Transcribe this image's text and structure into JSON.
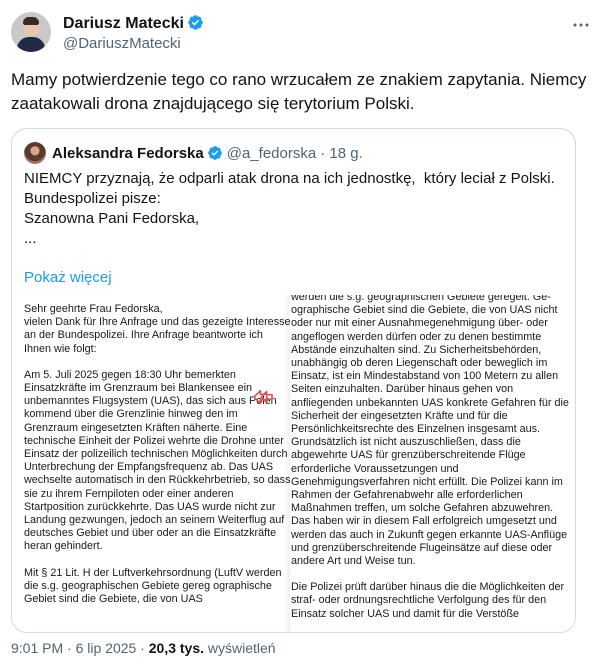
{
  "author": {
    "name": "Dariusz Matecki",
    "handle": "@DariuszMatecki"
  },
  "tweet": {
    "text": "Mamy potwierdzenie tego co rano wrzucałem ze znakiem zapytania. Niemcy zaatakowali drona znajdującego się terytorium Polski."
  },
  "quote": {
    "name": "Aleksandra Fedorska",
    "handle": "@a_fedorska",
    "time": "· 18 g.",
    "lines": [
      "NIEMCY przyznają, że odparli atak drona na ich jednostkę,  który leciał z Polski.",
      "Bundespolizei pisze:",
      "",
      "Szanowna Pani Fedorska,",
      "..."
    ],
    "show_more": "Pokaż więcej",
    "document": {
      "left_paragraphs": [
        "Sehr geehrte Frau Fedorska,\nvielen Dank für Ihre Anfrage und das gezeigte Interesse an der Bundespolizei. Ihre Anfrage beantworte ich Ihnen wie folgt:",
        "Am 5. Juli 2025 gegen 18:30 Uhr bemerkten Einsatzkräfte im Grenzraum bei Blankensee ein unbemanntes Flugsystem (UAS), das sich aus Polen kommend über die Grenzlinie hinweg den im Grenzraum eingesetzten Kräften näherte. Eine technische Einheit der Polizei wehrte die Drohne unter Einsatz der polizeilich technischen Möglichkeiten durch Unterbrechung der Empfangsfrequenz ab. Das UAS wechselte automatisch in den Rückkehrbetrieb, so dass sie zu ihrem Fernpiloten oder einer anderen Startposition zurückkehrte. Das UAS wurde nicht zur Landung gezwungen, jedoch an seinem Weiterflug auf deutsches Gebiet und über oder an die Einsatzkräfte heran gehindert.",
        "Mit § 21 Lit. H der Luftverkehrsordnung (LuftV werden die s.g. geographischen Gebiete gereg ographische Gebiet sind die Gebiete, die von UAS"
      ],
      "right_paragraphs": [
        "werden die s.g. geographischen Gebiete geregelt. Ge- ographische Gebiet sind die Gebiete, die von UAS nicht oder nur mit einer Ausnahmegenehmigung über- oder angeflogen werden dürfen oder zu denen bestimmte Abstände einzuhalten sind. Zu Sicherheitsbehörden, unabhängig ob deren Liegenschaft oder beweglich im Einsatz, ist ein Mindestabstand von 100 Metern zu allen Seiten einzuhalten. Darüber hinaus gehen von anfliegenden unbekannten UAS konkrete Gefahren für die Sicherheit der eingesetzten Kräfte und für die Persönlichkeitsrechte des Einzelnen insgesamt aus. Grundsätzlich ist nicht auszuschließen, dass die abgewehrte UAS für grenzüberschreitende Flüge erforderliche Voraussetzungen und Genehmigungsverfahren nicht erfüllt. Die Polizei kann im Rahmen der Gefahrenabwehr alle erforderlichen Maßnahmen treffen, um solche Gefahren abzuwehren. Das haben wir in diesem Fall erfolgreich umgesetzt und werden das auch in Zukunft gegen erkannte UAS-Anflüge und grenzüberschreitende Flugeinsätze auf diese oder andere Art und Weise tun.",
        "Die Polizei prüft darüber hinaus die die Möglichkeiten der straf- oder ordnungsrechtliche Verfolgung des für den Einsatz solcher UAS und damit für die Verstöße"
      ]
    }
  },
  "footer": {
    "time": "9:01 PM · 6 lip 2025 ·",
    "views_count": "20,3 tys.",
    "views_label": "wyświetleń"
  },
  "colors": {
    "verified": "#1d9bf0",
    "link": "#1d9bf0",
    "muted": "#536471",
    "border": "#cfd9de"
  },
  "icons": {
    "verified": "verified-badge-icon",
    "more": "more-dots-icon",
    "stamp": "red-arrows-icon"
  }
}
